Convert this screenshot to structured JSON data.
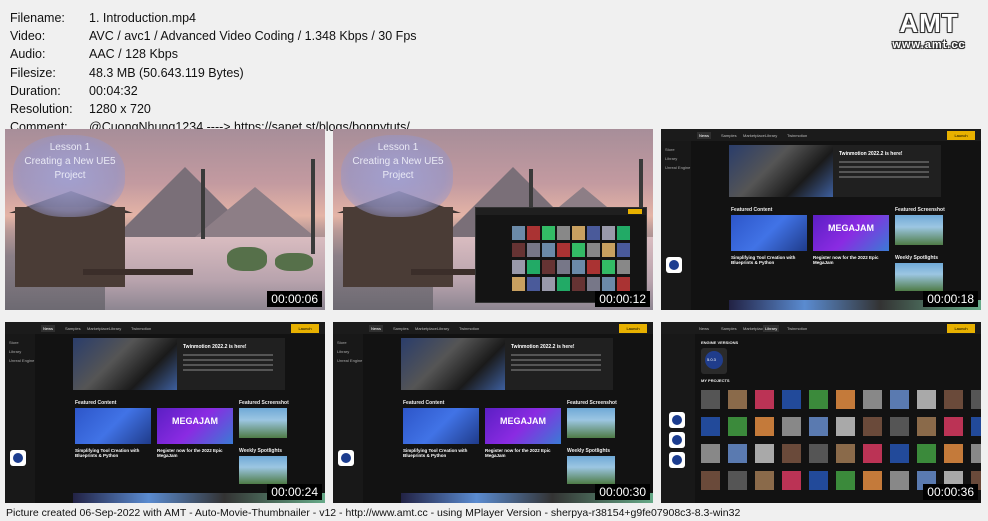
{
  "info": [
    {
      "key": "Filename:",
      "value": "1. Introduction.mp4"
    },
    {
      "key": "Video:",
      "value": "AVC / avc1 / Advanced Video Coding / 1.348 Kbps / 30 Fps"
    },
    {
      "key": "Audio:",
      "value": "AAC / 128 Kbps"
    },
    {
      "key": "Filesize:",
      "value": "48.3 MB (50.643.119 Bytes)"
    },
    {
      "key": "Duration:",
      "value": "00:04:32"
    },
    {
      "key": "Resolution:",
      "value": "1280 x 720"
    },
    {
      "key": "Comment:",
      "value": "@CuongNhung1234 ----> https://sanet.st/blogs/bonnytuts/"
    }
  ],
  "logo": {
    "main": "AMT",
    "sub": "www.amt.cc"
  },
  "thumbnails": [
    {
      "timestamp": "00:00:06",
      "kind": "scene",
      "lesson": [
        "Lesson 1",
        "Creating a New UE5",
        "Project"
      ]
    },
    {
      "timestamp": "00:00:12",
      "kind": "scene-overlay",
      "lesson": [
        "Lesson 1",
        "Creating a New UE5",
        "Project"
      ]
    },
    {
      "timestamp": "00:00:18",
      "kind": "launcher"
    },
    {
      "timestamp": "00:00:24",
      "kind": "launcher"
    },
    {
      "timestamp": "00:00:30",
      "kind": "launcher"
    },
    {
      "timestamp": "00:00:36",
      "kind": "library"
    }
  ],
  "launcher": {
    "tabs": [
      "News",
      "Samples",
      "Marketplace",
      "Library",
      "Twinmotion"
    ],
    "launch_label": "Launch",
    "sidebar": [
      "Store",
      "Library",
      "Unreal Engine"
    ],
    "banner_title": "Twinmotion 2022.2 is here!",
    "featured_label": "Featured Content",
    "screenshot_label": "Featured Screenshot",
    "card1_title": "Simplifying Tool Creation with Blueprints & Python",
    "card2_title": "Register now for the 2022 Epic MegaJam",
    "mega_text": "MEGAJAM",
    "weekly_label": "Weekly Spotlights",
    "library_engine_label": "ENGINE VERSIONS",
    "library_version": "5.0.3",
    "library_projects_label": "MY PROJECTS"
  },
  "footer": "Picture created 06-Sep-2022 with AMT - Auto-Movie-Thumbnailer - v12 - http://www.amt.cc - using MPlayer Version - sherpya-r38154+g9fe07908c3-8.3-win32"
}
